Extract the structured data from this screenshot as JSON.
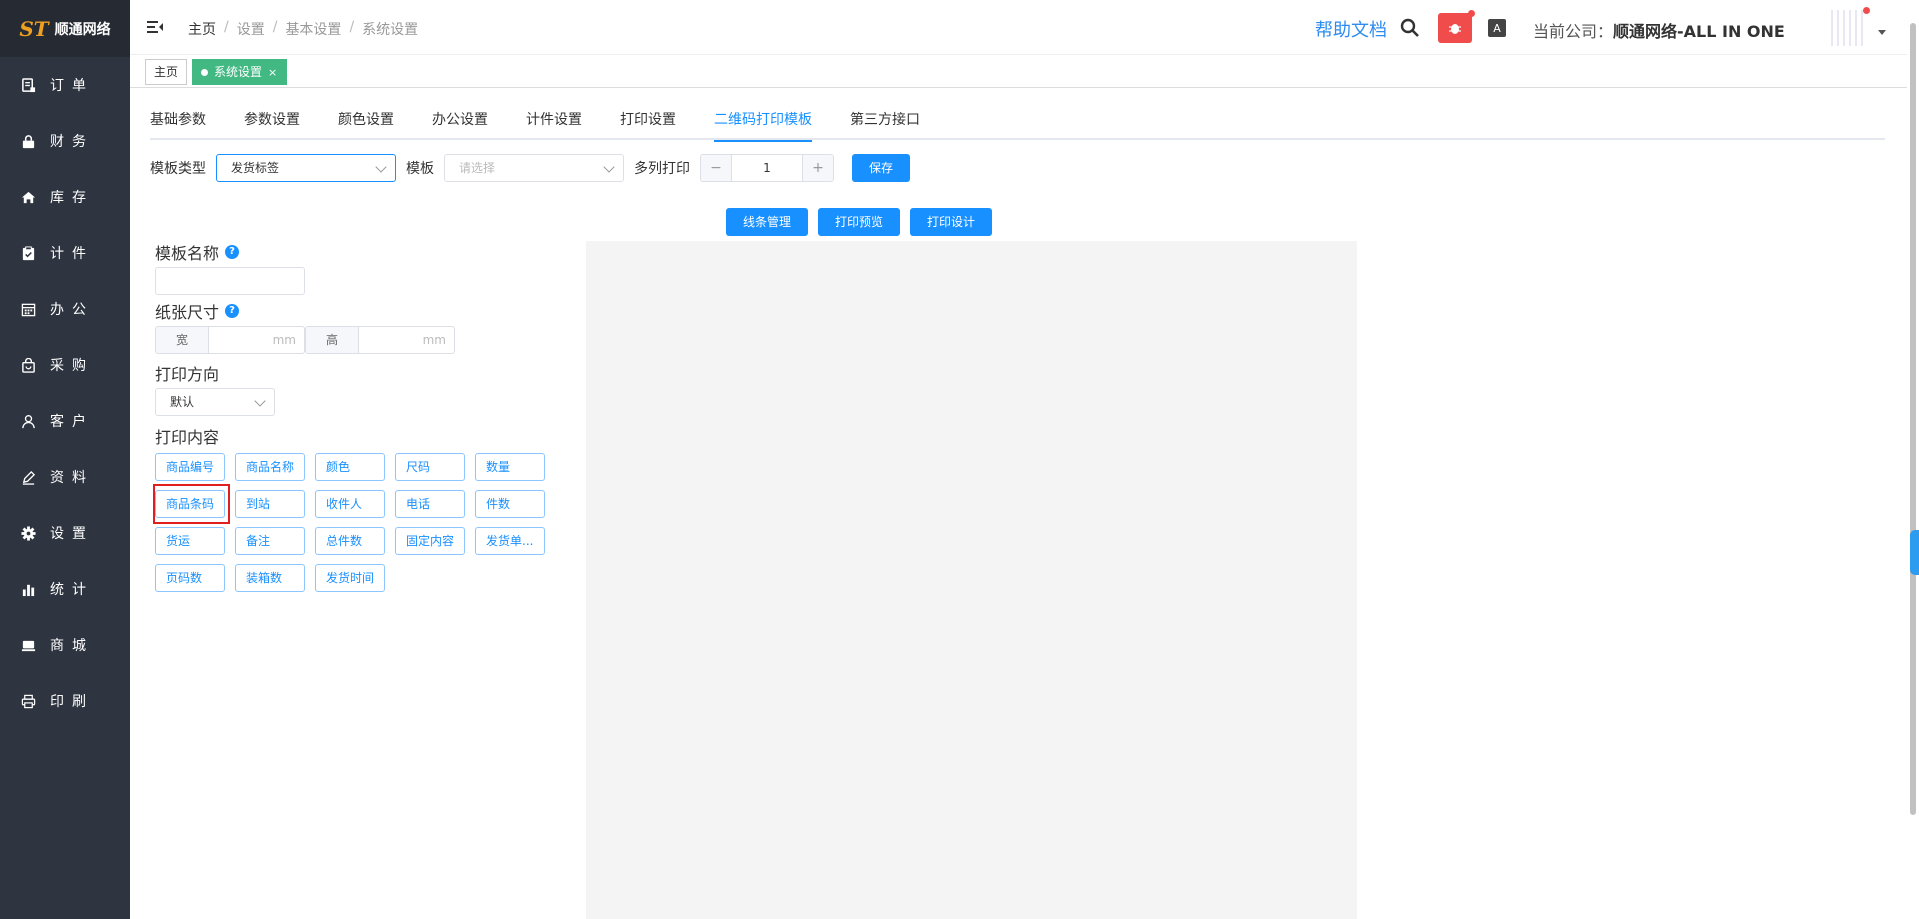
{
  "brand": {
    "mark": "ST",
    "name": "顺通网络"
  },
  "sidebar": {
    "items": [
      {
        "label": "订单",
        "icon": "order-icon"
      },
      {
        "label": "财务",
        "icon": "lock-icon"
      },
      {
        "label": "库存",
        "icon": "home-icon"
      },
      {
        "label": "计件",
        "icon": "clipboard-icon"
      },
      {
        "label": "办公",
        "icon": "calendar-icon"
      },
      {
        "label": "采购",
        "icon": "bag-icon"
      },
      {
        "label": "客户",
        "icon": "user-icon"
      },
      {
        "label": "资料",
        "icon": "pen-icon"
      },
      {
        "label": "设置",
        "icon": "gear-icon"
      },
      {
        "label": "统计",
        "icon": "bar-chart-icon"
      },
      {
        "label": "商城",
        "icon": "shop-icon"
      },
      {
        "label": "印刷",
        "icon": "printer-icon"
      }
    ]
  },
  "header": {
    "breadcrumb": [
      "主页",
      "设置",
      "基本设置",
      "系统设置"
    ],
    "help": "帮助文档",
    "company_label": "当前公司：",
    "company_name": "顺通网络-ALL IN ONE",
    "font_icon_text": "A"
  },
  "tags": {
    "home": "主页",
    "active": "系统设置",
    "close": "×"
  },
  "tabs": [
    "基础参数",
    "参数设置",
    "颜色设置",
    "办公设置",
    "计件设置",
    "打印设置",
    "二维码打印模板",
    "第三方接口"
  ],
  "active_tab": 6,
  "filter": {
    "type_label": "模板类型",
    "type_value": "发货标签",
    "template_label": "模板",
    "template_placeholder": "请选择",
    "multi_label": "多列打印",
    "minus": "−",
    "plus": "+",
    "multi_value": "1",
    "save": "保存"
  },
  "tools": {
    "line": "线条管理",
    "preview": "打印预览",
    "design": "打印设计"
  },
  "form": {
    "name_label": "模板名称",
    "help_glyph": "?",
    "size_label": "纸张尺寸",
    "width_label": "宽",
    "height_label": "高",
    "unit": "mm",
    "orient_label": "打印方向",
    "orient_value": "默认",
    "content_label": "打印内容"
  },
  "chips": [
    "商品编号",
    "商品名称",
    "颜色",
    "尺码",
    "数量",
    "商品条码",
    "到站",
    "收件人",
    "电话",
    "件数",
    "货运",
    "备注",
    "总件数",
    "固定内容",
    "发货单...",
    "页码数",
    "装箱数",
    "发货时间"
  ],
  "colors": {
    "sidebar": "#2f3540",
    "accent": "#1890ff",
    "tag_active": "#42b983",
    "danger": "#f04c4c"
  }
}
